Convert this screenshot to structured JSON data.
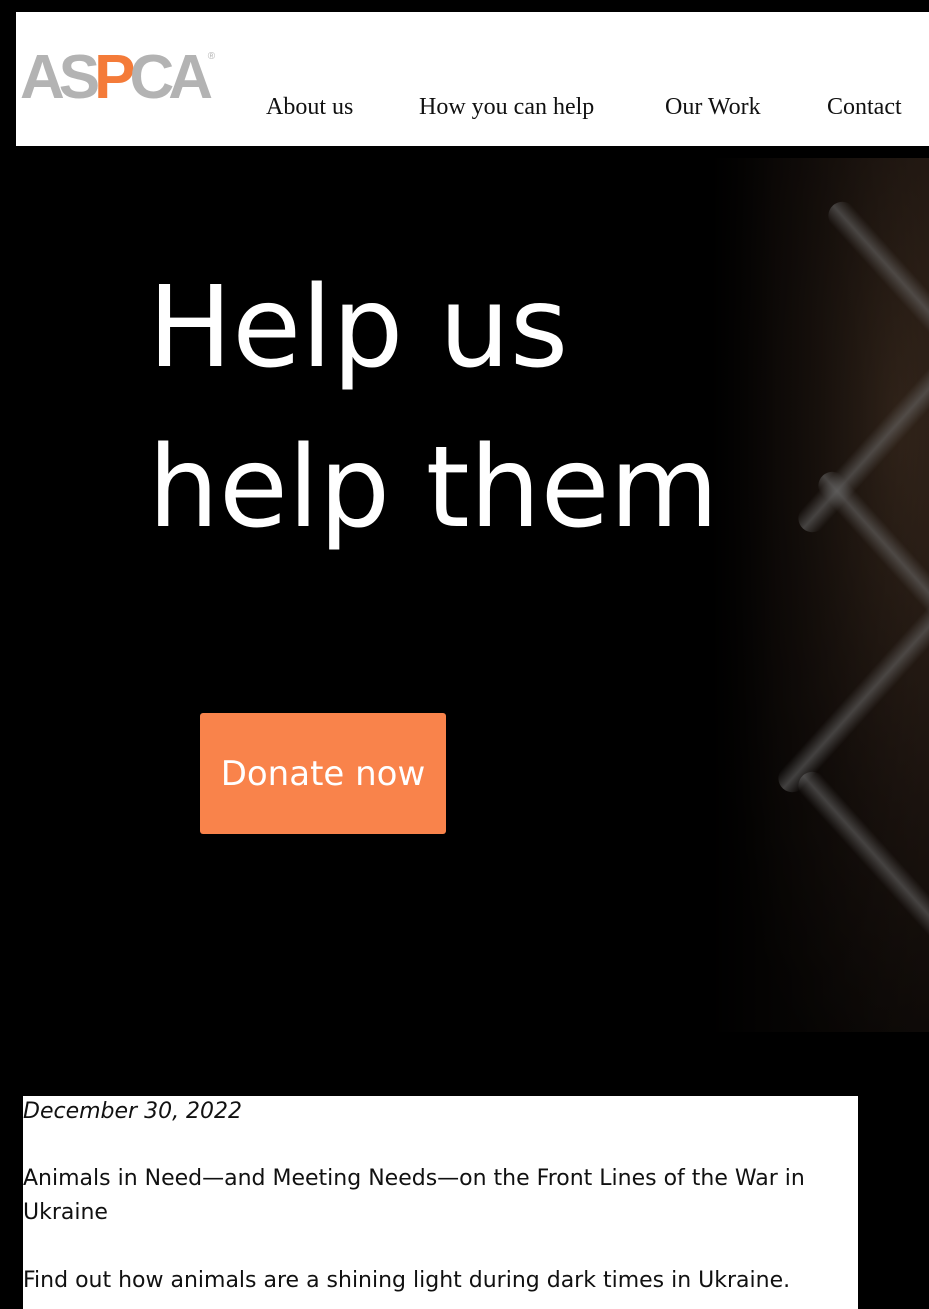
{
  "header": {
    "logo": {
      "part1": "AS",
      "part2": "P",
      "part3": "CA",
      "registered": "®"
    },
    "nav": [
      {
        "label": "About us"
      },
      {
        "label": "How you can help"
      },
      {
        "label": "Our Work"
      },
      {
        "label": "Contact"
      }
    ]
  },
  "hero": {
    "headline_line1": "Help us",
    "headline_line2": "help them",
    "donate_label": "Donate now"
  },
  "news": {
    "date": "December 30, 2022",
    "title": "Animals in Need—and Meeting Needs—on the Front Lines of the War in Ukraine",
    "description": "Find out how animals are a shining light during dark times in Ukraine."
  },
  "colors": {
    "brand_orange": "#f9834b",
    "logo_gray": "#b3b3b3",
    "background": "#000000"
  }
}
